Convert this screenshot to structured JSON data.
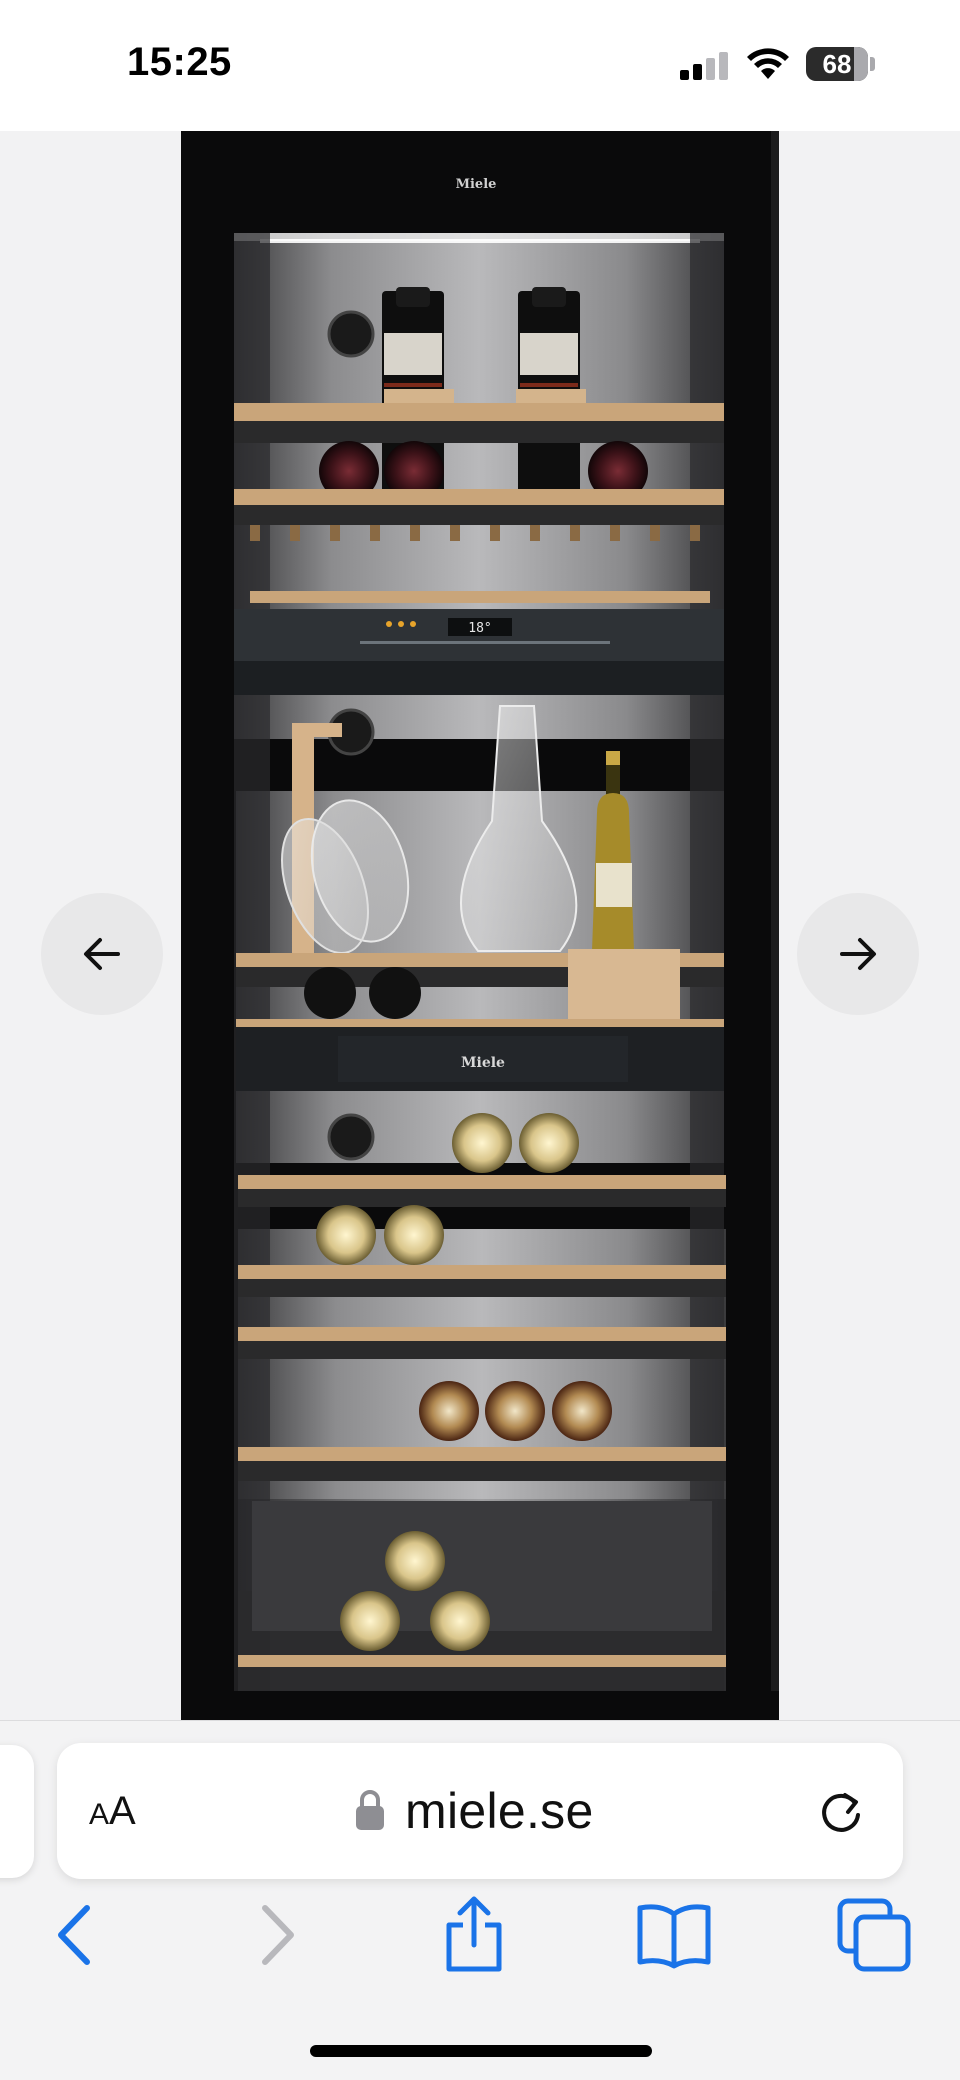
{
  "status_bar": {
    "time": "15:25",
    "battery_level": "68",
    "icons": [
      "cellular-signal-icon",
      "wifi-icon",
      "battery-icon"
    ]
  },
  "product_viewer": {
    "image_alt": "Miele",
    "brand_logo_top": "Miele",
    "brand_logo_middle": "Miele",
    "display_temperature": "18°",
    "prev_icon": "arrow-left-icon",
    "next_icon": "arrow-right-icon"
  },
  "browser": {
    "reader_label_small": "A",
    "reader_label_large": "A",
    "url": "miele.se",
    "icons": {
      "lock": "lock-icon",
      "reload": "reload-icon",
      "back": "chevron-left-icon",
      "forward": "chevron-right-icon",
      "share": "share-icon",
      "bookmarks": "book-icon",
      "tabs": "tabs-icon"
    },
    "colors": {
      "accent": "#1a73e8",
      "disabled": "#b8b8bc"
    }
  }
}
